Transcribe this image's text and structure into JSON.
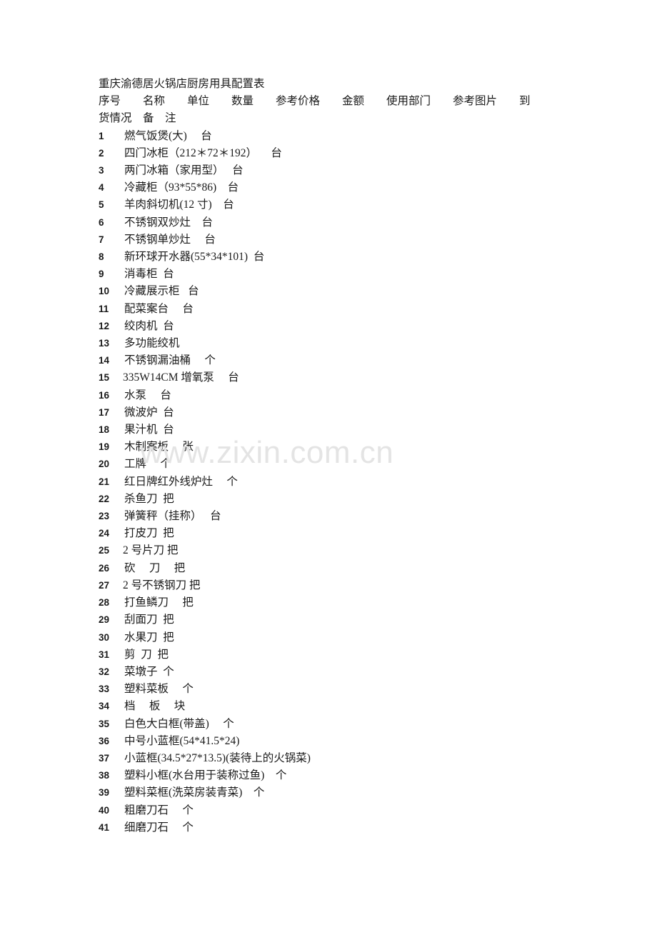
{
  "document": {
    "title": "重庆渝德居火锅店厨房用具配置表",
    "column_header_line_1": "序号\t名称\t单位\t数量\t参考价格\t金额\t使用部门\t参考图片\t到",
    "column_header_line_2": "货情况\t备\t注",
    "column_headers": [
      "序号",
      "名称",
      "单位",
      "数量",
      "参考价格",
      "金额",
      "使用部门",
      "参考图片",
      "到货情况",
      "备注"
    ]
  },
  "watermark": {
    "text": "www.zixin.com.cn",
    "color": "#e4e4e4"
  },
  "colors": {
    "page_background": "#ffffff",
    "text": "#1a1a1a",
    "watermark": "#e4e4e4"
  },
  "rows": [
    {
      "no": "1",
      "text": "燃气饭煲(大)     台"
    },
    {
      "no": "2",
      "text": "四门冰柜（212＊72＊192）     台"
    },
    {
      "no": "3",
      "text": "两门冰箱（家用型）   台"
    },
    {
      "no": "4",
      "text": "冷藏柜（93*55*86)    台"
    },
    {
      "no": "5",
      "text": "羊肉斜切机(12 寸)    台"
    },
    {
      "no": "6",
      "text": "不锈钢双炒灶    台"
    },
    {
      "no": "7",
      "text": "不锈钢单炒灶     台"
    },
    {
      "no": "8",
      "text": "新环球开水器(55*34*101)  台"
    },
    {
      "no": "9",
      "text": "消毒柜  台"
    },
    {
      "no": "10",
      "text": "冷藏展示柜   台"
    },
    {
      "no": "11",
      "text": "配菜案台     台"
    },
    {
      "no": "12",
      "text": "绞肉机  台"
    },
    {
      "no": "13",
      "text": "多功能绞机"
    },
    {
      "no": "14",
      "text": "不锈钢漏油桶     个"
    },
    {
      "no": "15",
      "text": "335W14CM 增氧泵     台",
      "tight": true
    },
    {
      "no": "16",
      "text": "水泵     台"
    },
    {
      "no": "17",
      "text": "微波炉  台"
    },
    {
      "no": "18",
      "text": "果汁机  台"
    },
    {
      "no": "19",
      "text": "木制案板     张"
    },
    {
      "no": "20",
      "text": "工牌     个"
    },
    {
      "no": "21",
      "text": "红日牌红外线炉灶     个"
    },
    {
      "no": "22",
      "text": "杀鱼刀  把"
    },
    {
      "no": "23",
      "text": "弹簧秤（挂称）   台"
    },
    {
      "no": "24",
      "text": "打皮刀  把"
    },
    {
      "no": "25",
      "text": "2 号片刀 把",
      "tight": true
    },
    {
      "no": "26",
      "text": "砍     刀     把"
    },
    {
      "no": "27",
      "text": "2 号不锈钢刀 把",
      "tight": true
    },
    {
      "no": "28",
      "text": "打鱼鳞刀     把"
    },
    {
      "no": "29",
      "text": "刮面刀  把"
    },
    {
      "no": "30",
      "text": "水果刀  把"
    },
    {
      "no": "31",
      "text": "剪  刀  把"
    },
    {
      "no": "32",
      "text": "菜墩子  个"
    },
    {
      "no": "33",
      "text": "塑料菜板     个"
    },
    {
      "no": "34",
      "text": "档     板     块"
    },
    {
      "no": "35",
      "text": "白色大白框(带盖)     个"
    },
    {
      "no": "36",
      "text": "中号小蓝框(54*41.5*24)"
    },
    {
      "no": "37",
      "text": "小蓝框(34.5*27*13.5)(装待上的火锅菜)"
    },
    {
      "no": "38",
      "text": "塑料小框(水台用于装称过鱼)    个"
    },
    {
      "no": "39",
      "text": "塑料菜框(洗菜房装青菜)    个"
    },
    {
      "no": "40",
      "text": "粗磨刀石     个"
    },
    {
      "no": "41",
      "text": "细磨刀石     个"
    }
  ]
}
